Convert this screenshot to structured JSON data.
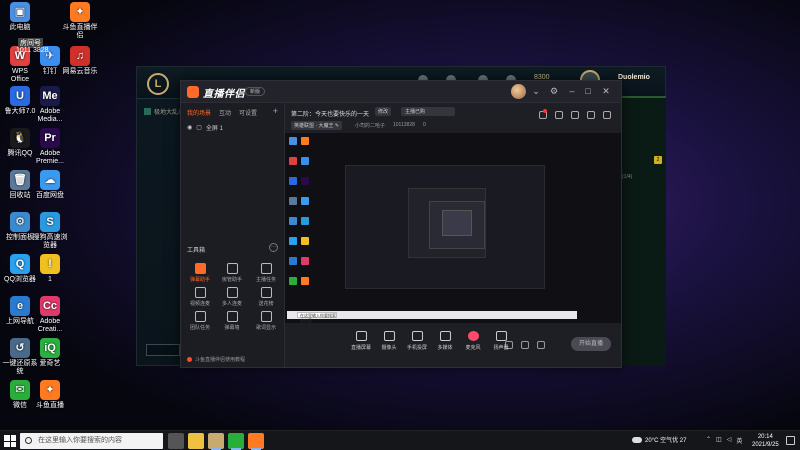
{
  "desktop_icons": [
    {
      "label": "此电脑",
      "color": "#4a90e2",
      "glyph": "▣"
    },
    {
      "label": "斗鱼直播伴侣",
      "color": "#ff7a20",
      "glyph": "✦"
    },
    {
      "label": "WPS Office",
      "color": "#e04040",
      "glyph": "W"
    },
    {
      "label": "钉钉",
      "color": "#3a8ef0",
      "glyph": "✈"
    },
    {
      "label": "网易云音乐",
      "color": "#d0302a",
      "glyph": "♫"
    },
    {
      "label": "鲁大师7.0",
      "color": "#2a6ae0",
      "glyph": "U"
    },
    {
      "label": "Adobe Media...",
      "color": "#1a1a4a",
      "glyph": "Me"
    },
    {
      "label": "腾讯QQ",
      "color": "#1a1a1a",
      "glyph": "🐧"
    },
    {
      "label": "Adobe Premie...",
      "color": "#2a0a4a",
      "glyph": "Pr"
    },
    {
      "label": "回收站",
      "color": "#5a7a9a",
      "glyph": "🗑"
    },
    {
      "label": "百度网盘",
      "color": "#3a9af0",
      "glyph": "☁"
    },
    {
      "label": "控制面板",
      "color": "#3a8ad0",
      "glyph": "⚙"
    },
    {
      "label": "搜狗高速浏览器",
      "color": "#2a9ae0",
      "glyph": "S"
    },
    {
      "label": "QQ浏览器",
      "color": "#2aa0f0",
      "glyph": "Q"
    },
    {
      "label": "1",
      "color": "#f0c020",
      "glyph": "!"
    },
    {
      "label": "上网导航",
      "color": "#2a7ad0",
      "glyph": "e"
    },
    {
      "label": "Adobe Creati...",
      "color": "#e03a6a",
      "glyph": "Cc"
    },
    {
      "label": "一键还原系统",
      "color": "#4a6a8a",
      "glyph": "↺"
    },
    {
      "label": "爱奇艺",
      "color": "#2ab040",
      "glyph": "iQ"
    },
    {
      "label": "微信",
      "color": "#2aae3a",
      "glyph": "✉"
    },
    {
      "label": "斗鱼直播",
      "color": "#ff7a20",
      "glyph": "✦"
    }
  ],
  "desktop_overlay_text": "1011 3828",
  "desktop_overlay_label": "房间号",
  "lol_client": {
    "blue_essence": "8300",
    "username": "Duolemio",
    "sidebar_item": "极地大乱斗",
    "counter": "(1/4)",
    "badge": "2"
  },
  "stream_app": {
    "title": "直播伴侣",
    "version": "新版",
    "tabs": [
      "我的场景",
      "互动",
      "可设置"
    ],
    "scene_name": "全屏 1",
    "room_title": "第二阶：今天也要快乐的一天",
    "edit_label": "修改",
    "room_info_label": "主播已购",
    "category": "英雄联盟 · 大魔王 ✎",
    "streamer_name": "小司的二哈子",
    "room_id": "10113828",
    "heat": "0",
    "toolbox_label": "工具箱",
    "toolbox_more": "···",
    "tools": [
      {
        "label": "弹幕助手",
        "active": true
      },
      {
        "label": "房管助手",
        "active": false
      },
      {
        "label": "主播任务",
        "active": false
      },
      {
        "label": "视频连麦",
        "active": false
      },
      {
        "label": "多人连麦",
        "active": false
      },
      {
        "label": "送花榜",
        "active": false
      },
      {
        "label": "团队任务",
        "active": false
      },
      {
        "label": "弹幕墙",
        "active": false
      },
      {
        "label": "歌词显示",
        "active": false
      }
    ],
    "footer": "斗鱼直播伴侣使用教程",
    "controls": [
      {
        "label": "直播屏幕",
        "red": false
      },
      {
        "label": "摄像头",
        "red": false
      },
      {
        "label": "手机投屏",
        "red": false
      },
      {
        "label": "多媒体",
        "red": false
      },
      {
        "label": "麦克风",
        "red": true
      },
      {
        "label": "扬声器",
        "red": false
      }
    ],
    "start_live": "开始直播",
    "preview_search": "在这里输入你要搜索的内容"
  },
  "taskbar": {
    "search_placeholder": "在这里输入你要搜索的内容",
    "weather": "20°C 空气优 27",
    "clock_time": "20:14",
    "clock_date": "2021/9/25",
    "apps": [
      {
        "name": "task-view",
        "color": "#555"
      },
      {
        "name": "file-explorer",
        "color": "#f0c040"
      },
      {
        "name": "league",
        "color": "#c8aa6e"
      },
      {
        "name": "wechat",
        "color": "#2aae3a"
      },
      {
        "name": "douyu",
        "color": "#ff7a20"
      }
    ]
  }
}
